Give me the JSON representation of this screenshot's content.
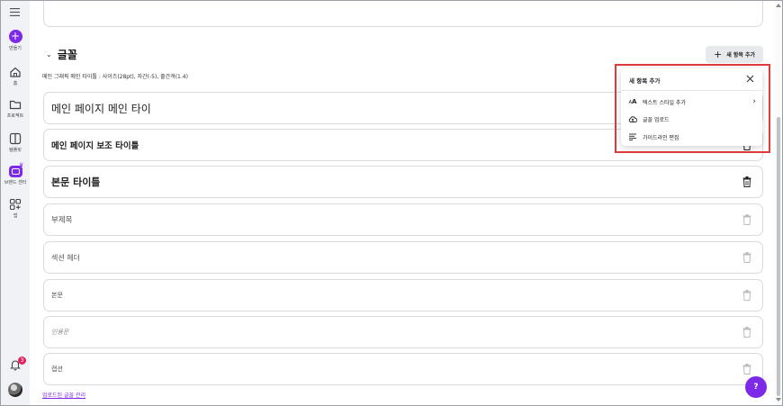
{
  "rail": {
    "create_label": "만들기",
    "items": [
      {
        "label": "홈",
        "icon": "home-icon"
      },
      {
        "label": "프로젝트",
        "icon": "folder-icon"
      },
      {
        "label": "템플릿",
        "icon": "template-icon"
      },
      {
        "label": "브랜드 센터",
        "icon": "brand-icon"
      },
      {
        "label": "앱",
        "icon": "apps-icon"
      }
    ],
    "notification_count": "3"
  },
  "section": {
    "title": "글꼴",
    "add_button_label": "새 항목 추가",
    "subtitle_info": "메인 그래픽 메인 타이틀 : 사이즈(28pt), 자간(-5), 줄간격(1.4)"
  },
  "rows": [
    {
      "text": "메인 페이지 메인 타이"
    },
    {
      "text": "메인 페이지 보조 타이틀"
    },
    {
      "text": "본문 타이틀"
    },
    {
      "text": "부제목"
    },
    {
      "text": "섹션 헤더"
    },
    {
      "text": "본문"
    },
    {
      "text": "인용문"
    },
    {
      "text": "캡션"
    }
  ],
  "manage_link": "업로드된 글꼴 관리",
  "dropdown": {
    "title": "새 항목 추가",
    "items": [
      {
        "label": "텍스트 스타일 추가",
        "icon": "text-style-icon"
      },
      {
        "label": "글꼴 업로드",
        "icon": "cloud-upload-icon"
      },
      {
        "label": "가이드라인 편집",
        "icon": "guidelines-icon"
      }
    ]
  },
  "help_label": "?",
  "colors": {
    "accent": "#7d2ae8",
    "highlight": "#e03a3a"
  }
}
